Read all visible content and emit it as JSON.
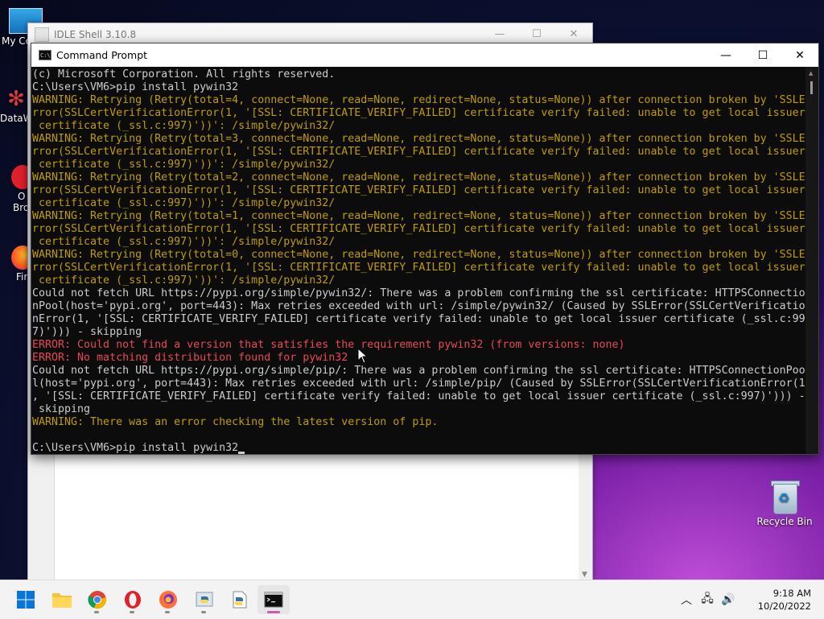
{
  "desktop": {
    "icons": [
      {
        "label": "My Co"
      },
      {
        "label": "DataW"
      },
      {
        "label": "O"
      },
      {
        "label": "Bro"
      },
      {
        "label": "Fir"
      }
    ],
    "recycle_bin": "Recycle Bin"
  },
  "idle_window": {
    "title": "IDLE Shell 3.10.8",
    "controls": [
      "—",
      "☐",
      "✕"
    ]
  },
  "cmd_window": {
    "title": "Command Prompt",
    "controls": [
      "—",
      "☐",
      "✕"
    ],
    "lines": [
      {
        "text": "(c) Microsoft Corporation. All rights reserved.",
        "type": "normal"
      },
      {
        "text": "C:\\Users\\VM6>pip install pywin32",
        "type": "normal"
      },
      {
        "text": "WARNING: Retrying (Retry(total=4, connect=None, read=None, redirect=None, status=None)) after connection broken by 'SSLE",
        "type": "warn"
      },
      {
        "text": "rror(SSLCertVerificationError(1, '[SSL: CERTIFICATE_VERIFY_FAILED] certificate verify failed: unable to get local issuer",
        "type": "warn"
      },
      {
        "text": " certificate (_ssl.c:997)'))': /simple/pywin32/",
        "type": "warn"
      },
      {
        "text": "WARNING: Retrying (Retry(total=3, connect=None, read=None, redirect=None, status=None)) after connection broken by 'SSLE",
        "type": "warn"
      },
      {
        "text": "rror(SSLCertVerificationError(1, '[SSL: CERTIFICATE_VERIFY_FAILED] certificate verify failed: unable to get local issuer",
        "type": "warn"
      },
      {
        "text": " certificate (_ssl.c:997)'))': /simple/pywin32/",
        "type": "warn"
      },
      {
        "text": "WARNING: Retrying (Retry(total=2, connect=None, read=None, redirect=None, status=None)) after connection broken by 'SSLE",
        "type": "warn"
      },
      {
        "text": "rror(SSLCertVerificationError(1, '[SSL: CERTIFICATE_VERIFY_FAILED] certificate verify failed: unable to get local issuer",
        "type": "warn"
      },
      {
        "text": " certificate (_ssl.c:997)'))': /simple/pywin32/",
        "type": "warn"
      },
      {
        "text": "WARNING: Retrying (Retry(total=1, connect=None, read=None, redirect=None, status=None)) after connection broken by 'SSLE",
        "type": "warn"
      },
      {
        "text": "rror(SSLCertVerificationError(1, '[SSL: CERTIFICATE_VERIFY_FAILED] certificate verify failed: unable to get local issuer",
        "type": "warn"
      },
      {
        "text": " certificate (_ssl.c:997)'))': /simple/pywin32/",
        "type": "warn"
      },
      {
        "text": "WARNING: Retrying (Retry(total=0, connect=None, read=None, redirect=None, status=None)) after connection broken by 'SSLE",
        "type": "warn"
      },
      {
        "text": "rror(SSLCertVerificationError(1, '[SSL: CERTIFICATE_VERIFY_FAILED] certificate verify failed: unable to get local issuer",
        "type": "warn"
      },
      {
        "text": " certificate (_ssl.c:997)'))': /simple/pywin32/",
        "type": "warn"
      },
      {
        "text": "Could not fetch URL https://pypi.org/simple/pywin32/: There was a problem confirming the ssl certificate: HTTPSConnectio",
        "type": "normal"
      },
      {
        "text": "nPool(host='pypi.org', port=443): Max retries exceeded with url: /simple/pywin32/ (Caused by SSLError(SSLCertVerificatio",
        "type": "normal"
      },
      {
        "text": "nError(1, '[SSL: CERTIFICATE_VERIFY_FAILED] certificate verify failed: unable to get local issuer certificate (_ssl.c:99",
        "type": "normal"
      },
      {
        "text": "7)'))) - skipping",
        "type": "normal"
      },
      {
        "text": "ERROR: Could not find a version that satisfies the requirement pywin32 (from versions: none)",
        "type": "err"
      },
      {
        "text": "ERROR: No matching distribution found for pywin32",
        "type": "err"
      },
      {
        "text": "Could not fetch URL https://pypi.org/simple/pip/: There was a problem confirming the ssl certificate: HTTPSConnectionPoo",
        "type": "normal"
      },
      {
        "text": "l(host='pypi.org', port=443): Max retries exceeded with url: /simple/pip/ (Caused by SSLError(SSLCertVerificationError(1",
        "type": "normal"
      },
      {
        "text": ", '[SSL: CERTIFICATE_VERIFY_FAILED] certificate verify failed: unable to get local issuer certificate (_ssl.c:997)'))) -",
        "type": "normal"
      },
      {
        "text": " skipping",
        "type": "normal"
      },
      {
        "text": "WARNING: There was an error checking the latest version of pip.",
        "type": "warn"
      },
      {
        "text": "",
        "type": "normal"
      },
      {
        "text": "C:\\Users\\VM6>pip install pywin32",
        "type": "normal"
      }
    ],
    "colors": {
      "normal": "#cccccc",
      "warn": "#c19c00",
      "err": "#e74856",
      "background": "#0c0c0c"
    }
  },
  "taskbar": {
    "apps": [
      {
        "name": "start",
        "icon": "windows-logo-icon",
        "pinned": true
      },
      {
        "name": "file-explorer",
        "icon": "folder-icon",
        "pinned": true
      },
      {
        "name": "chrome",
        "icon": "chrome-icon",
        "pinned": true
      },
      {
        "name": "opera",
        "icon": "opera-icon",
        "pinned": true
      },
      {
        "name": "firefox",
        "icon": "firefox-icon",
        "pinned": true
      },
      {
        "name": "python-idle",
        "icon": "python-icon",
        "pinned": true
      },
      {
        "name": "python-file",
        "icon": "python-file-icon",
        "pinned": true
      },
      {
        "name": "command-prompt",
        "icon": "cmd-icon",
        "pinned": true,
        "active": true
      }
    ],
    "tray": {
      "time": "9:18 AM",
      "date": "10/20/2022"
    }
  }
}
